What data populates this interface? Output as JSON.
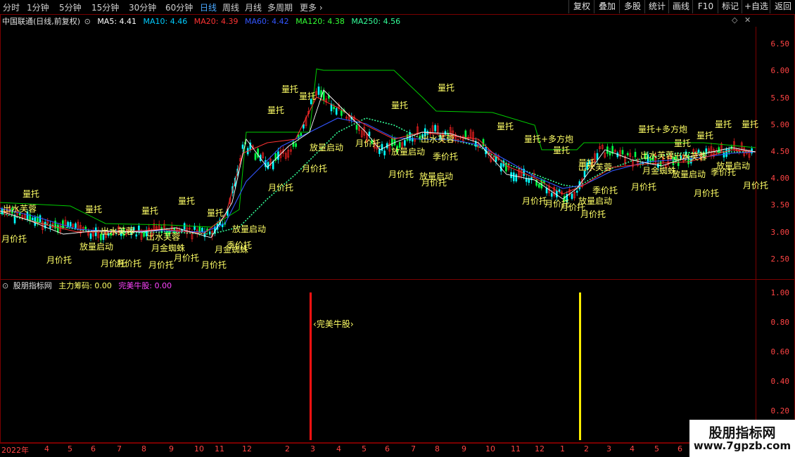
{
  "toolbar": {
    "periods": [
      "分时",
      "1分钟",
      "5分钟",
      "15分钟",
      "30分钟",
      "60分钟",
      "日线",
      "周线",
      "月线",
      "多周期",
      "更多"
    ],
    "active_period": "日线",
    "right_buttons": [
      "复权",
      "叠加",
      "多股",
      "统计",
      "画线",
      "F10",
      "标记",
      "+自选",
      "返回"
    ]
  },
  "main_panel": {
    "title": "中国联通(日线,前复权)",
    "ma": [
      {
        "label": "MA5: 4.41",
        "color": "#ffffff"
      },
      {
        "label": "MA10: 4.46",
        "color": "#00ccff"
      },
      {
        "label": "MA20: 4.39",
        "color": "#ff3333"
      },
      {
        "label": "MA60: 4.42",
        "color": "#3355ff"
      },
      {
        "label": "MA120: 4.38",
        "color": "#33ff33"
      },
      {
        "label": "MA250: 4.56",
        "color": "#33ff99"
      }
    ],
    "y_ticks": [
      "6.50",
      "6.00",
      "5.50",
      "5.00",
      "4.50",
      "4.00",
      "3.50",
      "3.00",
      "2.50"
    ]
  },
  "sub_panel": {
    "title": "股朋指标网",
    "zhuli_label": "主力筹码: 0.00",
    "niugu_label": "完美牛股: 0.00",
    "y_ticks": [
      "1.00",
      "0.80",
      "0.60",
      "0.40",
      "0.20"
    ],
    "niugu_annotation": "完美牛股"
  },
  "x_axis": [
    "2022年",
    "4",
    "5",
    "6",
    "7",
    "8",
    "9",
    "10",
    "11",
    "12",
    "2",
    "3",
    "4",
    "5",
    "6",
    "7",
    "8",
    "9",
    "10",
    "11",
    "12",
    "1",
    "2",
    "3",
    "4",
    "5",
    "6"
  ],
  "chart_labels": {
    "liangtuo": "量托",
    "yuejiatuo": "月价托",
    "fangliang": "放量启动",
    "chushui": "出水芙蓉",
    "jijiatuo": "季价托",
    "liangtuo_duofang": "量托+多方炮",
    "liangtuo_duofang2": "量托+多方炮",
    "jinzhizhu": "月金蜘蛛",
    "jinzhizhu2": "月金蜘蛛",
    "jinzhizhu3": "月金蜘蛛",
    "overlap_a": "月价托",
    "overlap_b": "量托",
    "overlap_c": "季价托"
  },
  "watermark": {
    "title": "股朋指标网",
    "url": "www.7gpzb.com"
  },
  "colors": {
    "up": "#ff2222",
    "down": "#00ff44",
    "axis": "#ff4444",
    "label": "#ffff66",
    "border": "#7a0000"
  }
}
